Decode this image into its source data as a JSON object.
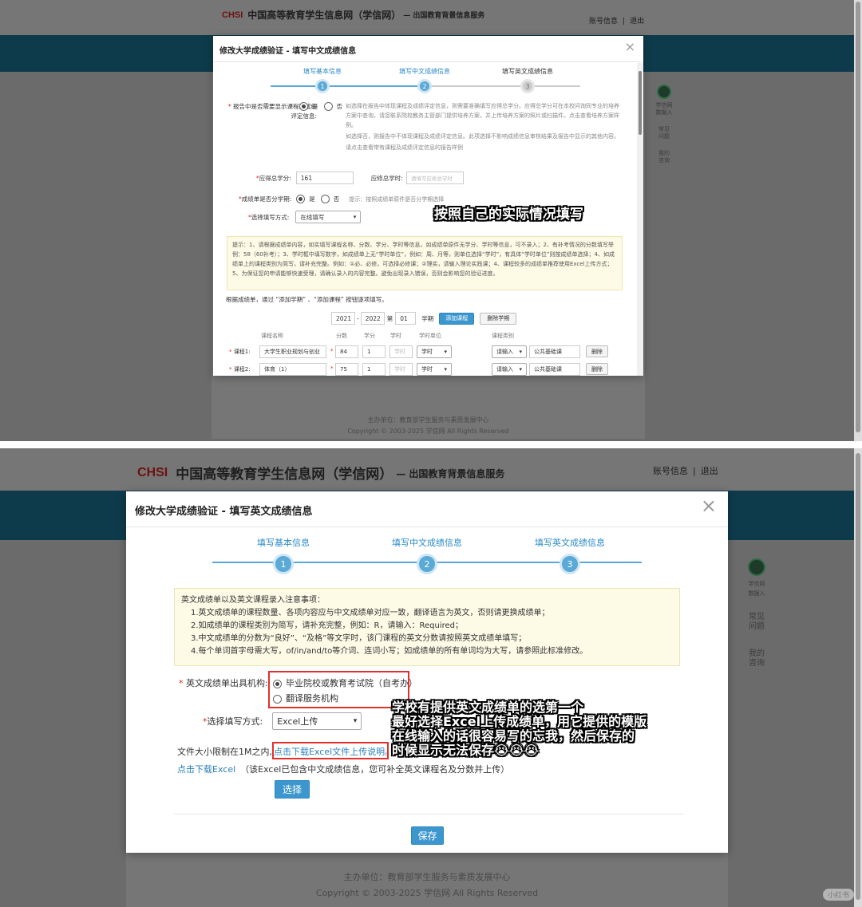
{
  "site": {
    "logo_mark": "CHSI",
    "title": "中国高等教育学生信息网（学信网）",
    "subtitle": "— 出国教育背景信息服务",
    "account": "账号信息",
    "logout": "退出",
    "sep": "|",
    "footer_org": "主办单位：教育部学生服务与素质发展中心",
    "footer_copy": "Copyright © 2003-2025 学信网 All Rights Reserved"
  },
  "side_menu": [
    "学信网\n数据入",
    "常见\n问题",
    "我的\n咨询"
  ],
  "top_modal": {
    "title": "修改大学成绩验证 - 填写中文成绩信息",
    "steps": [
      "填写基本信息",
      "填写中文成绩信息",
      "填写英文成绩信息"
    ],
    "step_nums": [
      "1",
      "2",
      "3"
    ],
    "q_show_label": "报告中是否需要显示课程及成绩评定信息:",
    "yes": "是",
    "no": "否",
    "q_show_tip1": "如选择在报告中体现课程及成绩评定信息，则需要准确填写应得总学分。应得总学分可在本校问询同专业的培养方案中查询，请您联系院校教务主管部门提供培养方案，并上传培养方案的照片或扫描件。点击查看培养方案样例。",
    "q_show_tip2": "如选择否，则报告中不体现课程及成绩评定信息。此项选择不影响成绩信息审核结果及报告中显示的其他内容。",
    "q_show_tip3": "请点击查看带有课程及成绩评定信息的报告样例",
    "credit_label": "应得总学分:",
    "credit_value": "161",
    "hours_label": "应修总学时:",
    "hours_placeholder": "请填写应修总学时",
    "term_label": "成绩单是否分学期:",
    "term_tip": "提示：按照成绩单原件是否分学期选择",
    "method_label": "选择填写方式:",
    "method_value": "在线填写",
    "notice": "提示：1、请根据成绩单内容，如实填写课程名称、分数、学分、学时等信息。如成绩单原件无学分、学时等信息，可不录入；2、有补考情况的分数填写举例：58（60补考）；3、学时框中填写数字，如成绩单上无“学时单位”，例如：周、月等，则单位选择“学时”，有具体“学时单位”则按成绩单选择；4、如成绩单上的课程类别为简写，请补充完整。例如：①必、必修，可选择必修课；②理实，请输入理论实践课；4、课程较多的成绩单推荐使用Excel上传方式；5、为保证您的申请能够快速受理，请确认录入的内容完整。避免出现录入错误，否则会影响您的验证进度。",
    "add_tip": "根据成绩单，通过 “添加学期” 、“添加课程” 按钮逐项填写。",
    "year_from": "2021",
    "year_to": "2022",
    "year_di": "第",
    "term_no": "01",
    "term_word": "学期",
    "add_course": "添加课程",
    "del_term": "删除学期",
    "col_headers": [
      "课程名称",
      "分数",
      "学分",
      "学时",
      "学时单位",
      "课程类别"
    ],
    "courses": [
      {
        "label": "课程1:",
        "name": "大学生职业规划与创业",
        "score": "84",
        "credit": "1",
        "hours": "学时",
        "unit": "学时",
        "type_sel": "请输入",
        "type": "公共基础课",
        "del": "删除"
      },
      {
        "label": "课程2:",
        "name": "体育（1）",
        "score": "75",
        "credit": "1",
        "hours": "学时",
        "unit": "学时",
        "type_sel": "请输入",
        "type": "公共基础课",
        "del": "删除"
      }
    ],
    "dash": "-",
    "annotation": "按照自己的实际情况填写"
  },
  "main_modal": {
    "title": "修改大学成绩验证 - 填写英文成绩信息",
    "steps": [
      "填写基本信息",
      "填写中文成绩信息",
      "填写英文成绩信息"
    ],
    "step_nums": [
      "1",
      "2",
      "3"
    ],
    "notice_title": "英文成绩单以及英文课程录入注意事项：",
    "notice_items": [
      "1.英文成绩单的课程数量、各项内容应与中文成绩单对应一致，翻译语言为英文，否则请更换成绩单；",
      "2.如成绩单的课程类别为简写，请补充完整，例如：R，请输入：Required；",
      "3.中文成绩单的分数为“良好”、“及格”等文字时，该门课程的英文分数请按照英文成绩单填写；",
      "4.每个单词首字母需大写，of/in/and/to等介词、连词小写；如成绩单的所有单词均为大写，请参照此标准修改。"
    ],
    "issuer_label": "英文成绩单出具机构:",
    "issuer_opt1": "毕业院校或教育考试院（自考办）",
    "issuer_opt2": "翻译服务机构",
    "method_label": "选择填写方式:",
    "method_value": "Excel上传",
    "file_limit": "文件大小限制在1M之内,",
    "upload_help": "点击下载Excel文件上传说明。",
    "download_excel": "点击下载Excel",
    "download_note": "（该Excel已包含中文成绩信息，您可补全英文课程名及分数并上传）",
    "choose_btn": "选择",
    "save_btn": "保存",
    "annotation_lines": [
      "学校有提供英文成绩单的选第一个",
      "最好选择Excel上传成绩单，用它提供的模版",
      "在线输入的话很容易写的忘我，然后保存的",
      "时候显示无法保存😭😭😭"
    ]
  },
  "watermark": "小红书"
}
